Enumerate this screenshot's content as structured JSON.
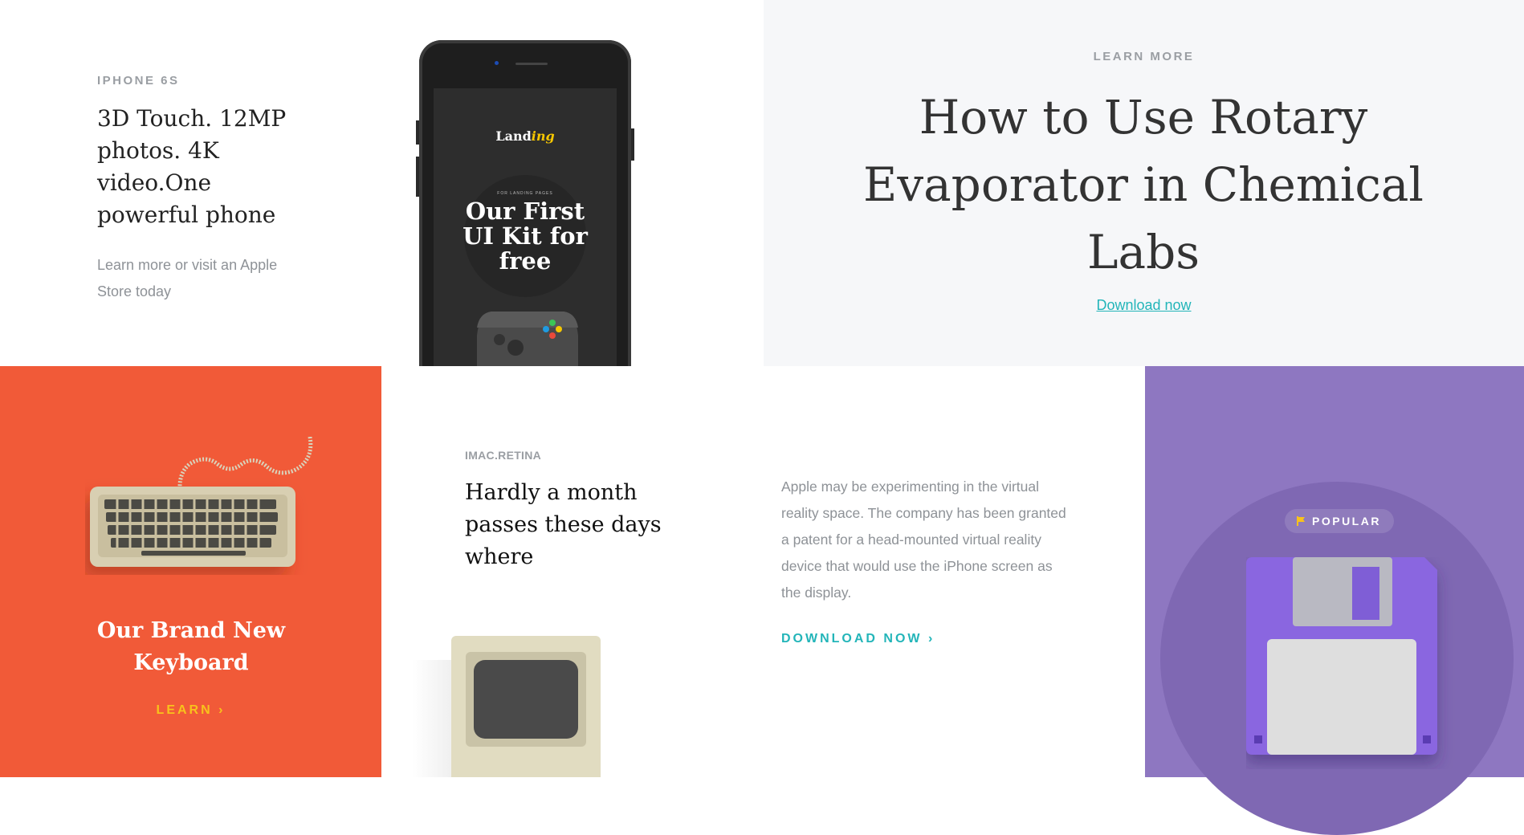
{
  "iphone_section": {
    "eyebrow": "IPHONE 6S",
    "title": "3D Touch. 12MP photos. 4K video.One powerful phone",
    "subtitle": "Learn more or visit an Apple Store today",
    "phone_screen": {
      "logo_prefix": "Land",
      "logo_suffix": "ing",
      "small_caption": "FOR LANDING PAGES",
      "title": "Our First UI Kit for free"
    }
  },
  "rotary_section": {
    "eyebrow": "LEARN MORE",
    "title": "How to Use Rotary Evaporator in Chemical Labs",
    "link": "Download now"
  },
  "keyboard_section": {
    "title": "Our Brand New Keyboard",
    "link": "LEARN",
    "link_arrow": "›"
  },
  "imac_section": {
    "eyebrow": "IMAC.RETINA",
    "title": "Hardly a month passes these days where",
    "description": "Apple may be experimenting in the virtual reality space. The company has been granted a patent for a head-mounted virtual reality device that would use the iPhone screen as the display.",
    "link": "DOWNLOAD NOW",
    "link_arrow": "›"
  },
  "floppy_section": {
    "badge": "POPULAR",
    "badge_icon": "flag-icon"
  },
  "colors": {
    "orange": "#f15a38",
    "purple": "#8e77c1",
    "teal": "#23b5b9",
    "yellow": "#f8c21c",
    "light_bg": "#f6f7f9"
  }
}
